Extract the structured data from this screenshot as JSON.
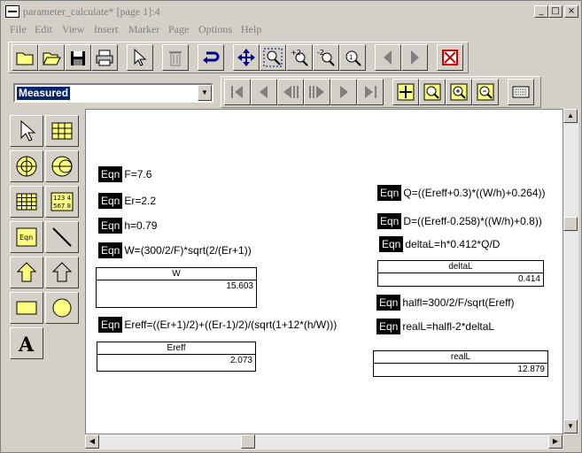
{
  "window": {
    "title": "parameter_calculate* [page 1]:4",
    "minimize": "_",
    "maximize": "□",
    "close": "×"
  },
  "menu": [
    "File",
    "Edit",
    "View",
    "Insert",
    "Marker",
    "Page",
    "Options",
    "Help"
  ],
  "combo": {
    "value": "Measured"
  },
  "toolbar1_icons": [
    "folder-icon",
    "open-folder-icon",
    "save-icon",
    "print-icon",
    "pointer-icon",
    "trash-icon",
    "undo-icon",
    "move-icon",
    "zoom-box-icon",
    "zoom-in-icon",
    "zoom-out-icon",
    "zoom-fit-icon",
    "prev-page-icon",
    "next-page-icon",
    "stop-icon"
  ],
  "toolbar2_icons": [
    "first-icon",
    "prev-icon",
    "prev-step-icon",
    "next-step-icon",
    "next-icon",
    "last-icon",
    "grid-icon",
    "zoom-data-icon",
    "zoom-data-in-icon",
    "zoom-data-out-icon",
    "export-icon"
  ],
  "palette": {
    "eqn_label": "Eqn",
    "numbers_label": "123 4\n567 8",
    "text_label": "A"
  },
  "equations": [
    {
      "tag": "Eqn",
      "expr": "F=7.6"
    },
    {
      "tag": "Eqn",
      "expr": "Er=2.2"
    },
    {
      "tag": "Eqn",
      "expr": "h=0.79"
    },
    {
      "tag": "Eqn",
      "expr": "W=(300/2/F)*sqrt(2/(Er+1))"
    },
    {
      "tag": "Eqn",
      "expr": "Ereff=((Er+1)/2)+((Er-1)/2)/(sqrt(1+12*(h/W)))"
    },
    {
      "tag": "Eqn",
      "expr": "Q=((Ereff+0.3)*((W/h)+0.264))"
    },
    {
      "tag": "Eqn",
      "expr": "D=((Ereff-0.258)*((W/h)+0.8))"
    },
    {
      "tag": "Eqn",
      "expr": "deltaL=h*0.412*Q/D"
    },
    {
      "tag": "Eqn",
      "expr": "halfl=300/2/F/sqrt(Ereff)"
    },
    {
      "tag": "Eqn",
      "expr": "realL=halfl-2*deltaL"
    }
  ],
  "boxes": [
    {
      "name": "W",
      "value": "15.603"
    },
    {
      "name": "Ereff",
      "value": "2.073"
    },
    {
      "name": "deltaL",
      "value": "0.414"
    },
    {
      "name": "realL",
      "value": "12.879"
    }
  ],
  "scroll": {
    "up": "▲",
    "down": "▼",
    "left": "◀",
    "right": "▶"
  }
}
